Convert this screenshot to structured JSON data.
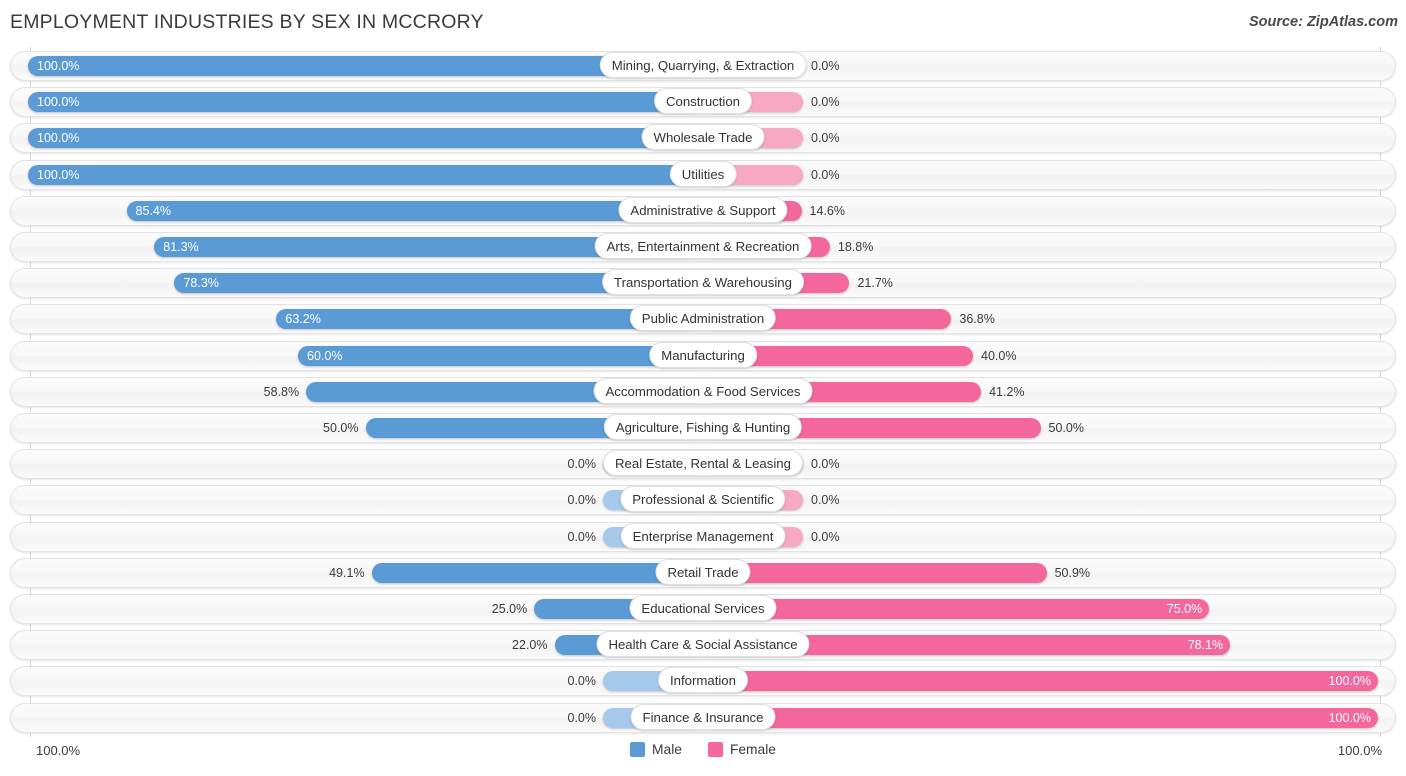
{
  "header": {
    "title": "EMPLOYMENT INDUSTRIES BY SEX IN MCCRORY",
    "source": "Source: ZipAtlas.com"
  },
  "legend": {
    "male_label": "Male",
    "female_label": "Female",
    "male_color": "#5b9bd5",
    "female_color": "#f4679d",
    "male_zero_color": "#a6c8ea",
    "female_zero_color": "#f7a9c4"
  },
  "axis": {
    "left_label": "100.0%",
    "right_label": "100.0%",
    "max": 100.0
  },
  "chart_data": {
    "type": "bar",
    "title": "EMPLOYMENT INDUSTRIES BY SEX IN MCCRORY",
    "subtitle": "Source: ZipAtlas.com",
    "orientation": "horizontal-diverging",
    "xlabel": "",
    "ylabel": "",
    "xlim": [
      100.0,
      100.0
    ],
    "grid": true,
    "legend_position": "bottom-center",
    "categories": [
      "Mining, Quarrying, & Extraction",
      "Construction",
      "Wholesale Trade",
      "Utilities",
      "Administrative & Support",
      "Arts, Entertainment & Recreation",
      "Transportation & Warehousing",
      "Public Administration",
      "Manufacturing",
      "Accommodation & Food Services",
      "Agriculture, Fishing & Hunting",
      "Real Estate, Rental & Leasing",
      "Professional & Scientific",
      "Enterprise Management",
      "Retail Trade",
      "Educational Services",
      "Health Care & Social Assistance",
      "Information",
      "Finance & Insurance"
    ],
    "series": [
      {
        "name": "Male",
        "values": [
          100.0,
          100.0,
          100.0,
          100.0,
          85.4,
          81.3,
          78.3,
          63.2,
          60.0,
          58.8,
          50.0,
          0.0,
          0.0,
          0.0,
          49.1,
          25.0,
          22.0,
          0.0,
          0.0
        ]
      },
      {
        "name": "Female",
        "values": [
          0.0,
          0.0,
          0.0,
          0.0,
          14.6,
          18.8,
          21.7,
          36.8,
          40.0,
          41.2,
          50.0,
          0.0,
          0.0,
          0.0,
          50.9,
          75.0,
          78.1,
          100.0,
          100.0
        ]
      }
    ]
  },
  "rows": [
    {
      "category": "Mining, Quarrying, & Extraction",
      "male": "100.0%",
      "female": "0.0%",
      "male_value": 100.0,
      "female_value": 0.0
    },
    {
      "category": "Construction",
      "male": "100.0%",
      "female": "0.0%",
      "male_value": 100.0,
      "female_value": 0.0
    },
    {
      "category": "Wholesale Trade",
      "male": "100.0%",
      "female": "0.0%",
      "male_value": 100.0,
      "female_value": 0.0
    },
    {
      "category": "Utilities",
      "male": "100.0%",
      "female": "0.0%",
      "male_value": 100.0,
      "female_value": 0.0
    },
    {
      "category": "Administrative & Support",
      "male": "85.4%",
      "female": "14.6%",
      "male_value": 85.4,
      "female_value": 14.6
    },
    {
      "category": "Arts, Entertainment & Recreation",
      "male": "81.3%",
      "female": "18.8%",
      "male_value": 81.3,
      "female_value": 18.8
    },
    {
      "category": "Transportation & Warehousing",
      "male": "78.3%",
      "female": "21.7%",
      "male_value": 78.3,
      "female_value": 21.7
    },
    {
      "category": "Public Administration",
      "male": "63.2%",
      "female": "36.8%",
      "male_value": 63.2,
      "female_value": 36.8
    },
    {
      "category": "Manufacturing",
      "male": "60.0%",
      "female": "40.0%",
      "male_value": 60.0,
      "female_value": 40.0
    },
    {
      "category": "Accommodation & Food Services",
      "male": "58.8%",
      "female": "41.2%",
      "male_value": 58.8,
      "female_value": 41.2
    },
    {
      "category": "Agriculture, Fishing & Hunting",
      "male": "50.0%",
      "female": "50.0%",
      "male_value": 50.0,
      "female_value": 50.0
    },
    {
      "category": "Real Estate, Rental & Leasing",
      "male": "0.0%",
      "female": "0.0%",
      "male_value": 0.0,
      "female_value": 0.0
    },
    {
      "category": "Professional & Scientific",
      "male": "0.0%",
      "female": "0.0%",
      "male_value": 0.0,
      "female_value": 0.0
    },
    {
      "category": "Enterprise Management",
      "male": "0.0%",
      "female": "0.0%",
      "male_value": 0.0,
      "female_value": 0.0
    },
    {
      "category": "Retail Trade",
      "male": "49.1%",
      "female": "50.9%",
      "male_value": 49.1,
      "female_value": 50.9
    },
    {
      "category": "Educational Services",
      "male": "25.0%",
      "female": "75.0%",
      "male_value": 25.0,
      "female_value": 75.0
    },
    {
      "category": "Health Care & Social Assistance",
      "male": "22.0%",
      "female": "78.1%",
      "male_value": 22.0,
      "female_value": 78.1
    },
    {
      "category": "Information",
      "male": "0.0%",
      "female": "100.0%",
      "male_value": 0.0,
      "female_value": 100.0
    },
    {
      "category": "Finance & Insurance",
      "male": "0.0%",
      "female": "100.0%",
      "male_value": 0.0,
      "female_value": 100.0
    }
  ]
}
